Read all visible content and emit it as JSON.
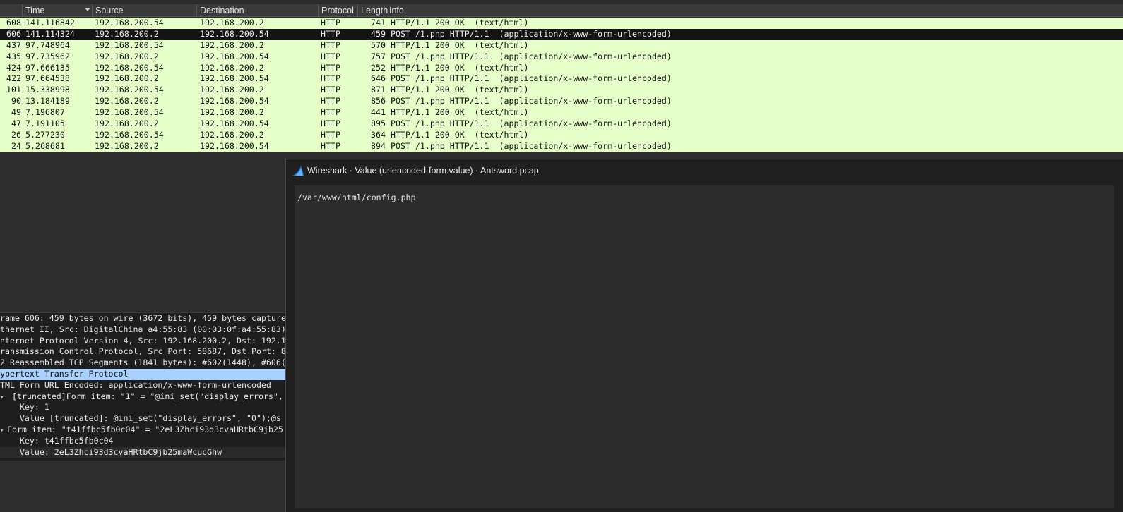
{
  "packet_list": {
    "columns": {
      "no": "",
      "time": "Time",
      "source": "Source",
      "destination": "Destination",
      "protocol": "Protocol",
      "length": "Length",
      "info": "Info"
    },
    "rows": [
      {
        "no": "608",
        "time": "141.116842",
        "src": "192.168.200.54",
        "dst": "192.168.200.2",
        "proto": "HTTP",
        "len": "741",
        "info": "HTTP/1.1 200 OK  (text/html)",
        "selected": false
      },
      {
        "no": "606",
        "time": "141.114324",
        "src": "192.168.200.2",
        "dst": "192.168.200.54",
        "proto": "HTTP",
        "len": "459",
        "info": "POST /1.php HTTP/1.1  (application/x-www-form-urlencoded)",
        "selected": true
      },
      {
        "no": "437",
        "time": "97.748964",
        "src": "192.168.200.54",
        "dst": "192.168.200.2",
        "proto": "HTTP",
        "len": "570",
        "info": "HTTP/1.1 200 OK  (text/html)",
        "selected": false
      },
      {
        "no": "435",
        "time": "97.735962",
        "src": "192.168.200.2",
        "dst": "192.168.200.54",
        "proto": "HTTP",
        "len": "757",
        "info": "POST /1.php HTTP/1.1  (application/x-www-form-urlencoded)",
        "selected": false
      },
      {
        "no": "424",
        "time": "97.666135",
        "src": "192.168.200.54",
        "dst": "192.168.200.2",
        "proto": "HTTP",
        "len": "252",
        "info": "HTTP/1.1 200 OK  (text/html)",
        "selected": false
      },
      {
        "no": "422",
        "time": "97.664538",
        "src": "192.168.200.2",
        "dst": "192.168.200.54",
        "proto": "HTTP",
        "len": "646",
        "info": "POST /1.php HTTP/1.1  (application/x-www-form-urlencoded)",
        "selected": false
      },
      {
        "no": "101",
        "time": "15.338998",
        "src": "192.168.200.54",
        "dst": "192.168.200.2",
        "proto": "HTTP",
        "len": "871",
        "info": "HTTP/1.1 200 OK  (text/html)",
        "selected": false
      },
      {
        "no": "90",
        "time": "13.184189",
        "src": "192.168.200.2",
        "dst": "192.168.200.54",
        "proto": "HTTP",
        "len": "856",
        "info": "POST /1.php HTTP/1.1  (application/x-www-form-urlencoded)",
        "selected": false
      },
      {
        "no": "49",
        "time": "7.196807",
        "src": "192.168.200.54",
        "dst": "192.168.200.2",
        "proto": "HTTP",
        "len": "441",
        "info": "HTTP/1.1 200 OK  (text/html)",
        "selected": false
      },
      {
        "no": "47",
        "time": "7.191105",
        "src": "192.168.200.2",
        "dst": "192.168.200.54",
        "proto": "HTTP",
        "len": "895",
        "info": "POST /1.php HTTP/1.1  (application/x-www-form-urlencoded)",
        "selected": false
      },
      {
        "no": "26",
        "time": "5.277230",
        "src": "192.168.200.54",
        "dst": "192.168.200.2",
        "proto": "HTTP",
        "len": "364",
        "info": "HTTP/1.1 200 OK  (text/html)",
        "selected": false
      },
      {
        "no": "24",
        "time": "5.268681",
        "src": "192.168.200.2",
        "dst": "192.168.200.54",
        "proto": "HTTP",
        "len": "894",
        "info": "POST /1.php HTTP/1.1  (application/x-www-form-urlencoded)",
        "selected": false
      }
    ]
  },
  "details": [
    {
      "text": "rame 606: 459 bytes on wire (3672 bits), 459 bytes capture",
      "twisty": "",
      "style": ""
    },
    {
      "text": "thernet II, Src: DigitalChina_a4:55:83 (00:03:0f:a4:55:83)",
      "twisty": "",
      "style": ""
    },
    {
      "text": "nternet Protocol Version 4, Src: 192.168.200.2, Dst: 192.1",
      "twisty": "",
      "style": ""
    },
    {
      "text": "ransmission Control Protocol, Src Port: 58687, Dst Port: 8",
      "twisty": "",
      "style": ""
    },
    {
      "text": "2 Reassembled TCP Segments (1841 bytes): #602(1448), #606(",
      "twisty": "",
      "style": ""
    },
    {
      "text": "ypertext Transfer Protocol",
      "twisty": "",
      "style": "hl"
    },
    {
      "text": "TML Form URL Encoded: application/x-www-form-urlencoded",
      "twisty": "",
      "style": ""
    },
    {
      "text": " [truncated]Form item: \"1\" = \"@ini_set(\"display_errors\",",
      "twisty": "▾",
      "style": ""
    },
    {
      "text": "    Key: 1",
      "twisty": "",
      "style": ""
    },
    {
      "text": "    Value [truncated]: @ini_set(\"display_errors\", \"0\");@s",
      "twisty": "",
      "style": ""
    },
    {
      "text": "Form item: \"t41ffbc5fb0c04\" = \"2eL3Zhci93d3cvaHRtbC9jb25",
      "twisty": "▾",
      "style": ""
    },
    {
      "text": "    Key: t41ffbc5fb0c04",
      "twisty": "",
      "style": ""
    },
    {
      "text": "    Value: 2eL3Zhci93d3cvaHRtbC9jb25maWcucGhw",
      "twisty": "",
      "style": "alt"
    }
  ],
  "dialog": {
    "title": "Wireshark · Value (urlencoded-form.value) · Antsword.pcap",
    "icon": "wireshark-fin-icon",
    "value": "/var/www/html/config.php"
  },
  "colors": {
    "row_bg": "#e4ffc7",
    "selected_row_bg": "#141414",
    "highlight_bg": "#a9d1ff",
    "shark_blue": "#1679d8"
  }
}
